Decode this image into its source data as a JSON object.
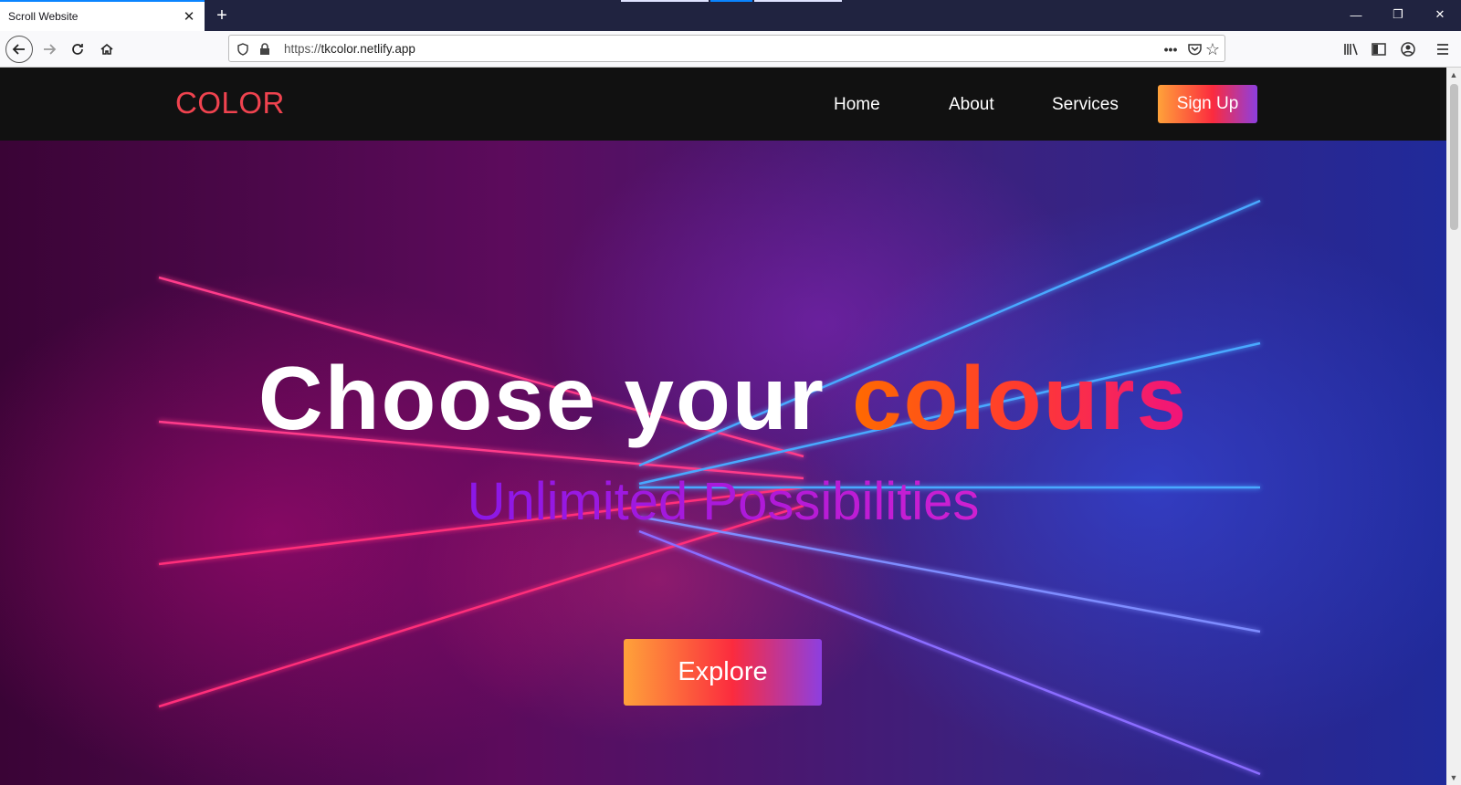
{
  "browser": {
    "tab_title": "Scroll Website",
    "url_scheme": "https://",
    "url_host": "tkcolor.netlify.app"
  },
  "site": {
    "logo": "COLOR",
    "nav": [
      "Home",
      "About",
      "Services"
    ],
    "signup_label": "Sign Up",
    "headline_main": "Choose your",
    "headline_accent": "colours",
    "tagline": "Unlimited Possibilities",
    "explore_label": "Explore"
  },
  "colors": {
    "logo": "#f0434f",
    "header_bg": "#111111",
    "button_gradient": [
      "#ffa23a",
      "#fb2b3e",
      "#8d3fe0"
    ]
  }
}
